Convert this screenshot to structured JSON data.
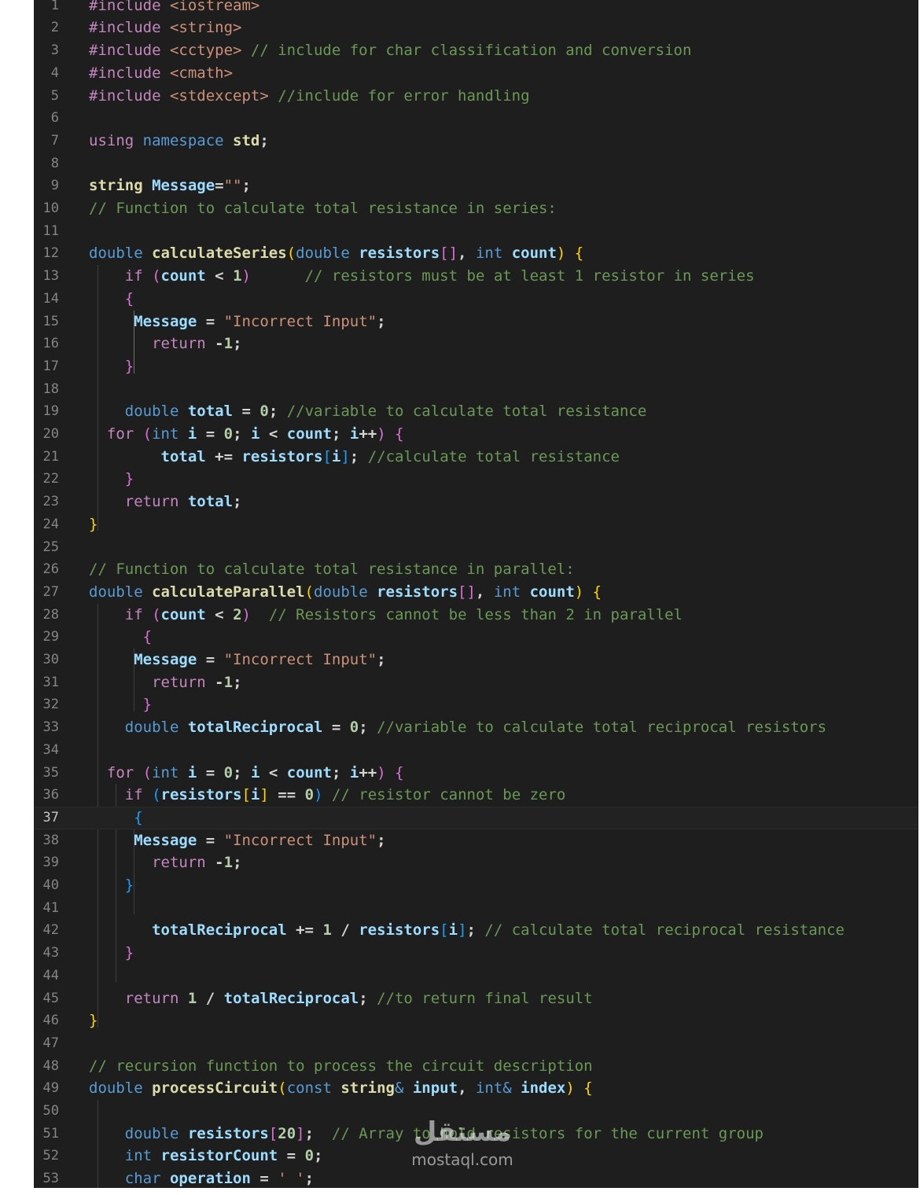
{
  "editor": {
    "colors": {
      "background": "#1e1e1e",
      "keyword": "#c586c0",
      "type": "#569cd6",
      "string": "#ce9178",
      "comment": "#6a9955",
      "function": "#dcdcaa",
      "variable": "#9cdcfe",
      "number": "#b5cea8",
      "default": "#d4d4d4",
      "bracket_gold": "#ffd700",
      "bracket_purple": "#da70d6",
      "bracket_blue": "#179fff"
    },
    "current_line": 37,
    "lines": [
      {
        "n": "1",
        "tokens": [
          [
            "#include ",
            "k"
          ],
          [
            "<iostream>",
            "s"
          ]
        ]
      },
      {
        "n": "2",
        "tokens": [
          [
            "#include ",
            "k"
          ],
          [
            "<string>",
            "s"
          ]
        ]
      },
      {
        "n": "3",
        "tokens": [
          [
            "#include ",
            "k"
          ],
          [
            "<cctype>",
            "s"
          ],
          [
            " // include for char classification and conversion",
            "c"
          ]
        ]
      },
      {
        "n": "4",
        "tokens": [
          [
            "#include ",
            "k"
          ],
          [
            "<cmath>",
            "s"
          ]
        ]
      },
      {
        "n": "5",
        "tokens": [
          [
            "#include ",
            "k"
          ],
          [
            "<stdexcept>",
            "s"
          ],
          [
            " //include for error handling",
            "c"
          ]
        ]
      },
      {
        "n": "6",
        "tokens": []
      },
      {
        "n": "7",
        "tokens": [
          [
            "using ",
            "k"
          ],
          [
            "namespace ",
            "t"
          ],
          [
            "std",
            "e"
          ],
          [
            ";",
            "d"
          ]
        ]
      },
      {
        "n": "8",
        "tokens": []
      },
      {
        "n": "9",
        "tokens": [
          [
            "string ",
            "e"
          ],
          [
            "Message",
            "v"
          ],
          [
            "=",
            "d"
          ],
          [
            "\"\"",
            "s"
          ],
          [
            ";",
            "d"
          ]
        ]
      },
      {
        "n": "10",
        "tokens": [
          [
            "// Function to calculate total resistance in series:",
            "c"
          ]
        ]
      },
      {
        "n": "11",
        "tokens": []
      },
      {
        "n": "12",
        "tokens": [
          [
            "double ",
            "t"
          ],
          [
            "calculateSeries",
            "f"
          ],
          [
            "(",
            "by"
          ],
          [
            "double ",
            "t"
          ],
          [
            "resistors",
            "v"
          ],
          [
            "[]",
            "bp"
          ],
          [
            ", ",
            "d"
          ],
          [
            "int ",
            "t"
          ],
          [
            "count",
            "v"
          ],
          [
            ") ",
            "by"
          ],
          [
            "{",
            "by"
          ]
        ]
      },
      {
        "n": "13",
        "tokens": [
          [
            "    if ",
            "k"
          ],
          [
            "(",
            "bp"
          ],
          [
            "count ",
            "v"
          ],
          [
            "< ",
            "d"
          ],
          [
            "1",
            "n"
          ],
          [
            ")",
            "bp"
          ],
          [
            "      // resistors must be at least 1 resistor in series",
            "c"
          ]
        ]
      },
      {
        "n": "14",
        "tokens": [
          [
            "    {",
            "bp"
          ]
        ]
      },
      {
        "n": "15",
        "tokens": [
          [
            "     Message ",
            "v"
          ],
          [
            "= ",
            "d"
          ],
          [
            "\"Incorrect Input\"",
            "s"
          ],
          [
            ";",
            "d"
          ]
        ]
      },
      {
        "n": "16",
        "tokens": [
          [
            "       return ",
            "k"
          ],
          [
            "-",
            "d"
          ],
          [
            "1",
            "n"
          ],
          [
            ";",
            "d"
          ]
        ]
      },
      {
        "n": "17",
        "tokens": [
          [
            "    }",
            "bp"
          ]
        ]
      },
      {
        "n": "18",
        "tokens": []
      },
      {
        "n": "19",
        "tokens": [
          [
            "    double ",
            "t"
          ],
          [
            "total ",
            "v"
          ],
          [
            "= ",
            "d"
          ],
          [
            "0",
            "n"
          ],
          [
            "; ",
            "d"
          ],
          [
            "//variable to calculate total resistance",
            "c"
          ]
        ]
      },
      {
        "n": "20",
        "tokens": [
          [
            "  for ",
            "k"
          ],
          [
            "(",
            "bp"
          ],
          [
            "int ",
            "t"
          ],
          [
            "i ",
            "v"
          ],
          [
            "= ",
            "d"
          ],
          [
            "0",
            "n"
          ],
          [
            "; ",
            "d"
          ],
          [
            "i ",
            "v"
          ],
          [
            "< ",
            "d"
          ],
          [
            "count",
            "v"
          ],
          [
            "; ",
            "d"
          ],
          [
            "i",
            "v"
          ],
          [
            "++",
            "d"
          ],
          [
            ") ",
            "bp"
          ],
          [
            "{",
            "bp"
          ]
        ]
      },
      {
        "n": "21",
        "tokens": [
          [
            "        total ",
            "v"
          ],
          [
            "+= ",
            "d"
          ],
          [
            "resistors",
            "v"
          ],
          [
            "[",
            "bb"
          ],
          [
            "i",
            "v"
          ],
          [
            "]",
            "bb"
          ],
          [
            "; ",
            "d"
          ],
          [
            "//calculate total resistance",
            "c"
          ]
        ]
      },
      {
        "n": "22",
        "tokens": [
          [
            "    }",
            "bp"
          ]
        ]
      },
      {
        "n": "23",
        "tokens": [
          [
            "    return ",
            "k"
          ],
          [
            "total",
            "v"
          ],
          [
            ";",
            "d"
          ]
        ]
      },
      {
        "n": "24",
        "tokens": [
          [
            "}",
            "by"
          ]
        ]
      },
      {
        "n": "25",
        "tokens": []
      },
      {
        "n": "26",
        "tokens": [
          [
            "// Function to calculate total resistance in parallel:",
            "c"
          ]
        ]
      },
      {
        "n": "27",
        "tokens": [
          [
            "double ",
            "t"
          ],
          [
            "calculateParallel",
            "f"
          ],
          [
            "(",
            "by"
          ],
          [
            "double ",
            "t"
          ],
          [
            "resistors",
            "v"
          ],
          [
            "[]",
            "bp"
          ],
          [
            ", ",
            "d"
          ],
          [
            "int ",
            "t"
          ],
          [
            "count",
            "v"
          ],
          [
            ") ",
            "by"
          ],
          [
            "{",
            "by"
          ]
        ]
      },
      {
        "n": "28",
        "tokens": [
          [
            "    if ",
            "k"
          ],
          [
            "(",
            "bp"
          ],
          [
            "count ",
            "v"
          ],
          [
            "< ",
            "d"
          ],
          [
            "2",
            "n"
          ],
          [
            ")",
            "bp"
          ],
          [
            "  // Resistors cannot be less than 2 in parallel",
            "c"
          ]
        ]
      },
      {
        "n": "29",
        "tokens": [
          [
            "      {",
            "bp"
          ]
        ]
      },
      {
        "n": "30",
        "tokens": [
          [
            "     Message ",
            "v"
          ],
          [
            "= ",
            "d"
          ],
          [
            "\"Incorrect Input\"",
            "s"
          ],
          [
            ";",
            "d"
          ]
        ]
      },
      {
        "n": "31",
        "tokens": [
          [
            "       return ",
            "k"
          ],
          [
            "-",
            "d"
          ],
          [
            "1",
            "n"
          ],
          [
            ";",
            "d"
          ]
        ]
      },
      {
        "n": "32",
        "tokens": [
          [
            "      }",
            "bp"
          ]
        ]
      },
      {
        "n": "33",
        "tokens": [
          [
            "    double ",
            "t"
          ],
          [
            "totalReciprocal ",
            "v"
          ],
          [
            "= ",
            "d"
          ],
          [
            "0",
            "n"
          ],
          [
            "; ",
            "d"
          ],
          [
            "//variable to calculate total reciprocal resistors",
            "c"
          ]
        ]
      },
      {
        "n": "34",
        "tokens": []
      },
      {
        "n": "35",
        "tokens": [
          [
            "  for ",
            "k"
          ],
          [
            "(",
            "bp"
          ],
          [
            "int ",
            "t"
          ],
          [
            "i ",
            "v"
          ],
          [
            "= ",
            "d"
          ],
          [
            "0",
            "n"
          ],
          [
            "; ",
            "d"
          ],
          [
            "i ",
            "v"
          ],
          [
            "< ",
            "d"
          ],
          [
            "count",
            "v"
          ],
          [
            "; ",
            "d"
          ],
          [
            "i",
            "v"
          ],
          [
            "++",
            "d"
          ],
          [
            ") ",
            "bp"
          ],
          [
            "{",
            "bp"
          ]
        ]
      },
      {
        "n": "36",
        "tokens": [
          [
            "    if ",
            "k"
          ],
          [
            "(",
            "bb"
          ],
          [
            "resistors",
            "v"
          ],
          [
            "[",
            "by"
          ],
          [
            "i",
            "v"
          ],
          [
            "] ",
            "by"
          ],
          [
            "== ",
            "d"
          ],
          [
            "0",
            "n"
          ],
          [
            ")",
            "bb"
          ],
          [
            " // resistor cannot be zero",
            "c"
          ]
        ]
      },
      {
        "n": "37",
        "tokens": [
          [
            "     {",
            "bb"
          ]
        ]
      },
      {
        "n": "38",
        "tokens": [
          [
            "     Message ",
            "v"
          ],
          [
            "= ",
            "d"
          ],
          [
            "\"Incorrect Input\"",
            "s"
          ],
          [
            ";",
            "d"
          ]
        ]
      },
      {
        "n": "39",
        "tokens": [
          [
            "       return ",
            "k"
          ],
          [
            "-",
            "d"
          ],
          [
            "1",
            "n"
          ],
          [
            ";",
            "d"
          ]
        ]
      },
      {
        "n": "40",
        "tokens": [
          [
            "    }",
            "bb"
          ]
        ]
      },
      {
        "n": "41",
        "tokens": []
      },
      {
        "n": "42",
        "tokens": [
          [
            "       totalReciprocal ",
            "v"
          ],
          [
            "+= ",
            "d"
          ],
          [
            "1 ",
            "n"
          ],
          [
            "/ ",
            "d"
          ],
          [
            "resistors",
            "v"
          ],
          [
            "[",
            "bb"
          ],
          [
            "i",
            "v"
          ],
          [
            "]",
            "bb"
          ],
          [
            "; ",
            "d"
          ],
          [
            "// calculate total reciprocal resistance",
            "c"
          ]
        ]
      },
      {
        "n": "43",
        "tokens": [
          [
            "    }",
            "bp"
          ]
        ]
      },
      {
        "n": "44",
        "tokens": []
      },
      {
        "n": "45",
        "tokens": [
          [
            "    return ",
            "k"
          ],
          [
            "1 ",
            "n"
          ],
          [
            "/ ",
            "d"
          ],
          [
            "totalReciprocal",
            "v"
          ],
          [
            "; ",
            "d"
          ],
          [
            "//to return final result",
            "c"
          ]
        ]
      },
      {
        "n": "46",
        "tokens": [
          [
            "}",
            "by"
          ]
        ]
      },
      {
        "n": "47",
        "tokens": []
      },
      {
        "n": "48",
        "tokens": [
          [
            "// recursion function to process the circuit description",
            "c"
          ]
        ]
      },
      {
        "n": "49",
        "tokens": [
          [
            "double ",
            "t"
          ],
          [
            "processCircuit",
            "f"
          ],
          [
            "(",
            "by"
          ],
          [
            "const ",
            "t"
          ],
          [
            "string",
            "e"
          ],
          [
            "& ",
            "t"
          ],
          [
            "input",
            "v"
          ],
          [
            ", ",
            "d"
          ],
          [
            "int",
            "t"
          ],
          [
            "& ",
            "t"
          ],
          [
            "index",
            "v"
          ],
          [
            ") ",
            "by"
          ],
          [
            "{",
            "by"
          ]
        ]
      },
      {
        "n": "50",
        "tokens": []
      },
      {
        "n": "51",
        "tokens": [
          [
            "    double ",
            "t"
          ],
          [
            "resistors",
            "v"
          ],
          [
            "[",
            "bp"
          ],
          [
            "20",
            "n"
          ],
          [
            "]",
            "bp"
          ],
          [
            ";  ",
            "d"
          ],
          [
            "// Array to hold resistors for the current group",
            "c"
          ]
        ]
      },
      {
        "n": "52",
        "tokens": [
          [
            "    int ",
            "t"
          ],
          [
            "resistorCount ",
            "v"
          ],
          [
            "= ",
            "d"
          ],
          [
            "0",
            "n"
          ],
          [
            ";",
            "d"
          ]
        ]
      },
      {
        "n": "53",
        "tokens": [
          [
            "    char ",
            "t"
          ],
          [
            "operation ",
            "v"
          ],
          [
            "= ",
            "d"
          ],
          [
            "' '",
            "s"
          ],
          [
            ";",
            "d"
          ]
        ]
      }
    ]
  },
  "watermark": {
    "arabic": "مستقل",
    "latin": "mostaql.com"
  }
}
